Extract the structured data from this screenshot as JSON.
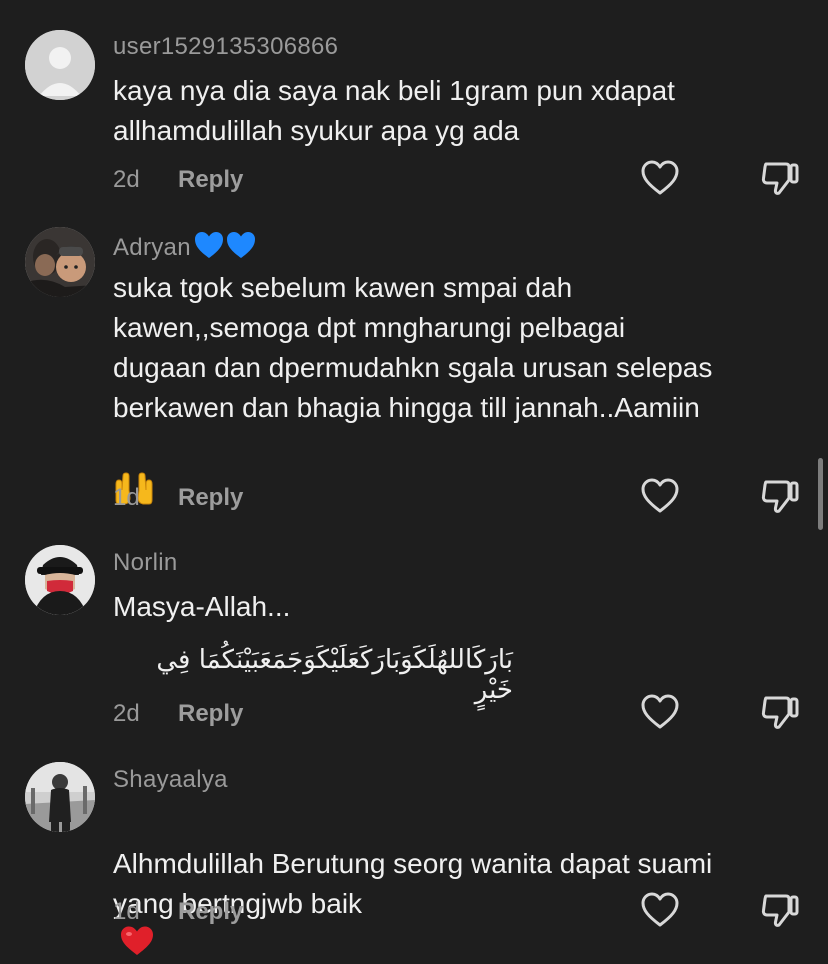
{
  "comments": [
    {
      "username": "user1529135306866",
      "text": "kaya nya dia saya nak beli 1gram pun xdapat\nallhamdulillah syukur apa yg ada",
      "age": "2d",
      "reply": "Reply"
    },
    {
      "username": "Adryan",
      "username_emoji": "💙💙",
      "text": "suka tgok sebelum kawen smpai dah\nkawen,,semoga dpt mngharungi pelbagai\ndugaan dan dpermudahkn sgala urusan selepas\nberkawen dan bhagia hingga till jannah..Aamiin",
      "emoji_line": "🤲",
      "age": "1d",
      "reply": "Reply"
    },
    {
      "username": "Norlin",
      "text": "Masya-Allah...",
      "arabic": "بَارَكَاللهُلَكَوَبَارَكَعَلَيْكَوَجَمَعَبَيْنَكُمَا فِي خَيْرٍ",
      "age": "2d",
      "reply": "Reply"
    },
    {
      "username": "Shayaalya",
      "text": "Alhmdulillah Berutung seorg wanita dapat suami\nyang bertngjwb baik",
      "trailing_emoji": "❤️",
      "age": "1d",
      "reply": "Reply"
    }
  ],
  "icons": {
    "like": "heart-outline-icon",
    "dislike": "thumbs-down-outline-icon"
  },
  "colors": {
    "background": "#1e1e1e",
    "username": "#9a9a9a",
    "text": "#f0f0f0",
    "heart_emoji": "#e0202a",
    "blue_heart": "#1e88ff"
  }
}
